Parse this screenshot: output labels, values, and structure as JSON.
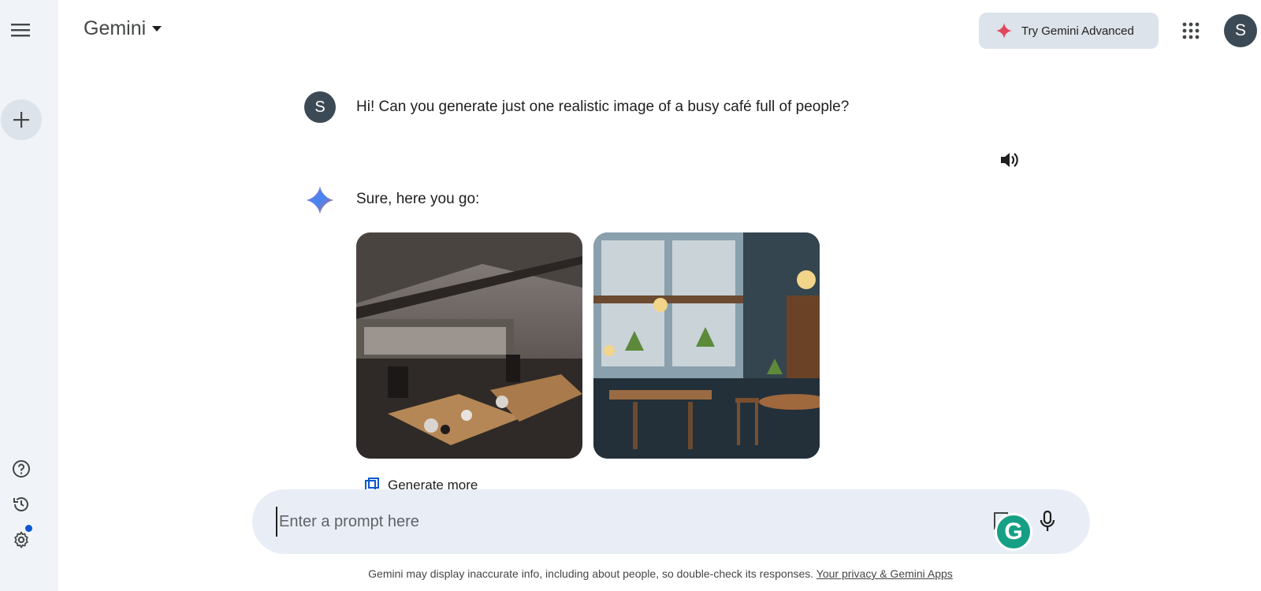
{
  "sidebar": {
    "menu_icon": "hamburger-menu-icon",
    "new_chat_icon": "plus-icon",
    "help_icon": "help-circle-icon",
    "history_icon": "history-icon",
    "settings_icon": "gear-icon"
  },
  "header": {
    "app_name": "Gemini",
    "advanced_button": "Try Gemini Advanced",
    "user_initial": "S"
  },
  "conversation": {
    "user_initial": "S",
    "user_message": "Hi! Can you generate just one realistic image of a busy café full of people?",
    "response_text": "Sure, here you go:",
    "images": [
      {
        "name": "generated-image-1",
        "description": "dim industrial café interior"
      },
      {
        "name": "generated-image-2",
        "description": "plant-filled café with hanging lamps"
      }
    ],
    "generate_more": "Generate more"
  },
  "prompt": {
    "placeholder": "Enter a prompt here"
  },
  "footer": {
    "disclaimer": "Gemini may display inaccurate info, including about people, so double-check its responses.",
    "link": "Your privacy & Gemini Apps"
  },
  "colors": {
    "sidebar_bg": "#f0f4f9",
    "prompt_bg": "#e9eef6",
    "advanced_bg": "#dde3ea",
    "avatar_bg": "#3c4a55",
    "accent": "#0b57d0"
  }
}
